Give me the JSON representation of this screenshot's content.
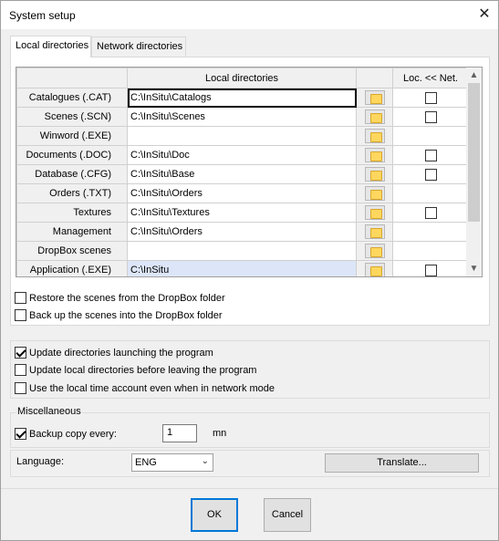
{
  "window": {
    "title": "System setup",
    "close_glyph": "✕"
  },
  "tabs": [
    {
      "label": "Local directories",
      "active": true
    },
    {
      "label": "Network directories",
      "active": false
    }
  ],
  "grid": {
    "columns": {
      "path": "Local directories",
      "sync": "Loc. << Net."
    },
    "rows": [
      {
        "label": "Catalogues (.CAT)",
        "path": "C:\\InSitu\\Catalogs",
        "has_check": true,
        "checked": false
      },
      {
        "label": "Scenes (.SCN)",
        "path": "C:\\InSitu\\Scenes",
        "has_check": true,
        "checked": false
      },
      {
        "label": "Winword (.EXE)",
        "path": "",
        "has_check": false,
        "checked": false
      },
      {
        "label": "Documents (.DOC)",
        "path": "C:\\InSitu\\Doc",
        "has_check": true,
        "checked": false
      },
      {
        "label": "Database (.CFG)",
        "path": "C:\\InSitu\\Base",
        "has_check": true,
        "checked": false
      },
      {
        "label": "Orders (.TXT)",
        "path": "C:\\InSitu\\Orders",
        "has_check": false,
        "checked": false
      },
      {
        "label": "Textures",
        "path": "C:\\InSitu\\Textures",
        "has_check": true,
        "checked": false
      },
      {
        "label": "Management",
        "path": "C:\\InSitu\\Orders",
        "has_check": false,
        "checked": false
      },
      {
        "label": "DropBox scenes",
        "path": "",
        "has_check": false,
        "checked": false
      },
      {
        "label": "Application (.EXE)",
        "path": "C:\\InSitu",
        "has_check": true,
        "checked": false
      }
    ]
  },
  "dropbox": {
    "restore_label": "Restore the scenes from the DropBox folder",
    "restore_checked": false,
    "backup_label": "Back up the scenes into the DropBox folder",
    "backup_checked": false
  },
  "options": {
    "update_dirs_label": "Update directories launching the program",
    "update_dirs_checked": true,
    "update_local_label": "Update local directories before leaving the program",
    "update_local_checked": false,
    "local_time_label": "Use the local time account even when in network mode",
    "local_time_checked": false
  },
  "misc": {
    "group_label": "Miscellaneous",
    "backup_label": "Backup copy every:",
    "backup_checked": true,
    "backup_value": "1",
    "backup_unit": "mn"
  },
  "language": {
    "label": "Language:",
    "value": "ENG",
    "translate_label": "Translate..."
  },
  "footer": {
    "ok_label": "OK",
    "cancel_label": "Cancel"
  }
}
